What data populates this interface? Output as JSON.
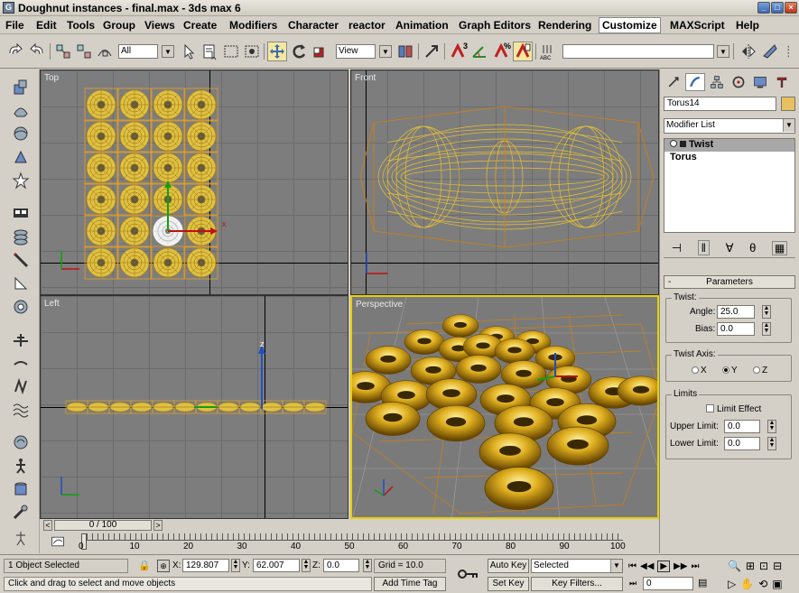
{
  "window": {
    "title": "Doughnut instances - final.max - 3ds max 6",
    "app_icon": "G",
    "minimize": "_",
    "maximize": "□",
    "close": "×"
  },
  "menu": [
    "File",
    "Edit",
    "Tools",
    "Group",
    "Views",
    "Create",
    "Modifiers",
    "Character",
    "reactor",
    "Animation",
    "Graph Editors",
    "Rendering",
    "Customize",
    "MAXScript",
    "Help"
  ],
  "toolbar": {
    "selection_filter": "All",
    "reference_coord": "View",
    "named_selection": "",
    "snap_3": "3",
    "snap_pct": "%",
    "abc": "ABC"
  },
  "viewports": {
    "top": "Top",
    "front": "Front",
    "left": "Left",
    "perspective": "Perspective",
    "axis_x": "x",
    "axis_y": "y",
    "axis_z": "z"
  },
  "command_panel": {
    "object_name": "Torus14",
    "object_color": "#e8c060",
    "modifier_list": "Modifier List",
    "stack": [
      "Twist",
      "Torus"
    ],
    "rollout_minus": "-",
    "rollout_title": "Parameters",
    "twist_group": "Twist:",
    "angle_label": "Angle:",
    "angle_value": "25.0",
    "bias_label": "Bias:",
    "bias_value": "0.0",
    "axis_group": "Twist Axis:",
    "axis_x": "X",
    "axis_y": "Y",
    "axis_z": "Z",
    "axis_selected": "Y",
    "limits_group": "Limits",
    "limit_effect": "Limit Effect",
    "upper_label": "Upper Limit:",
    "upper_value": "0.0",
    "lower_label": "Lower Limit:",
    "lower_value": "0.0"
  },
  "timeline": {
    "frame_display": "0 / 100",
    "ticks": [
      "0",
      "10",
      "20",
      "30",
      "40",
      "50",
      "60",
      "70",
      "80",
      "90",
      "100"
    ]
  },
  "status": {
    "selection": "1 Object Selected",
    "prompt": "Click and drag to select and move objects",
    "x_label": "X:",
    "x_value": "129.807",
    "y_label": "Y:",
    "y_value": "62.007",
    "z_label": "Z:",
    "z_value": "0.0",
    "grid": "Grid = 10.0",
    "add_time_tag": "Add Time Tag",
    "auto_key": "Auto Key",
    "set_key": "Set Key",
    "key_mode": "Selected",
    "key_filters": "Key Filters...",
    "frame": "0"
  }
}
